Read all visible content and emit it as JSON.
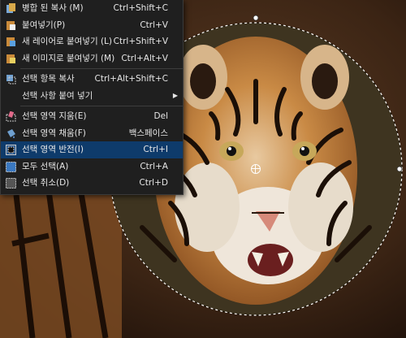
{
  "menu": {
    "items": [
      {
        "label": "병합 된 복사 (M)",
        "shortcut": "Ctrl+Shift+C",
        "icon": "merged-copy-icon"
      },
      {
        "label": "붙여넣기(P)",
        "shortcut": "Ctrl+V",
        "icon": "paste-icon"
      },
      {
        "label": "새 레이어로 붙여넣기 (L)",
        "shortcut": "Ctrl+Shift+V",
        "icon": "paste-into-new-layer-icon"
      },
      {
        "label": "새 이미지로 붙여넣기 (M)",
        "shortcut": "Ctrl+Alt+V",
        "icon": "paste-into-new-image-icon"
      },
      {
        "label": "선택 항목 복사",
        "shortcut": "Ctrl+Alt+Shift+C",
        "icon": "copy-selection-icon"
      },
      {
        "label": "선택 사항 붙여 넣기",
        "shortcut": "",
        "icon": "paste-selection-icon"
      },
      {
        "label": "선택 영역 지움(E)",
        "shortcut": "Del",
        "icon": "erase-selection-icon"
      },
      {
        "label": "선택 영역 채움(F)",
        "shortcut": "백스페이스",
        "icon": "fill-selection-icon"
      },
      {
        "label": "선택 영역 반전(I)",
        "shortcut": "Ctrl+I",
        "icon": "invert-selection-icon"
      },
      {
        "label": "모두 선택(A)",
        "shortcut": "Ctrl+A",
        "icon": "select-all-icon"
      },
      {
        "label": "선택 취소(D)",
        "shortcut": "Ctrl+D",
        "icon": "deselect-icon"
      }
    ],
    "highlight_color": "#0e3b6b"
  }
}
